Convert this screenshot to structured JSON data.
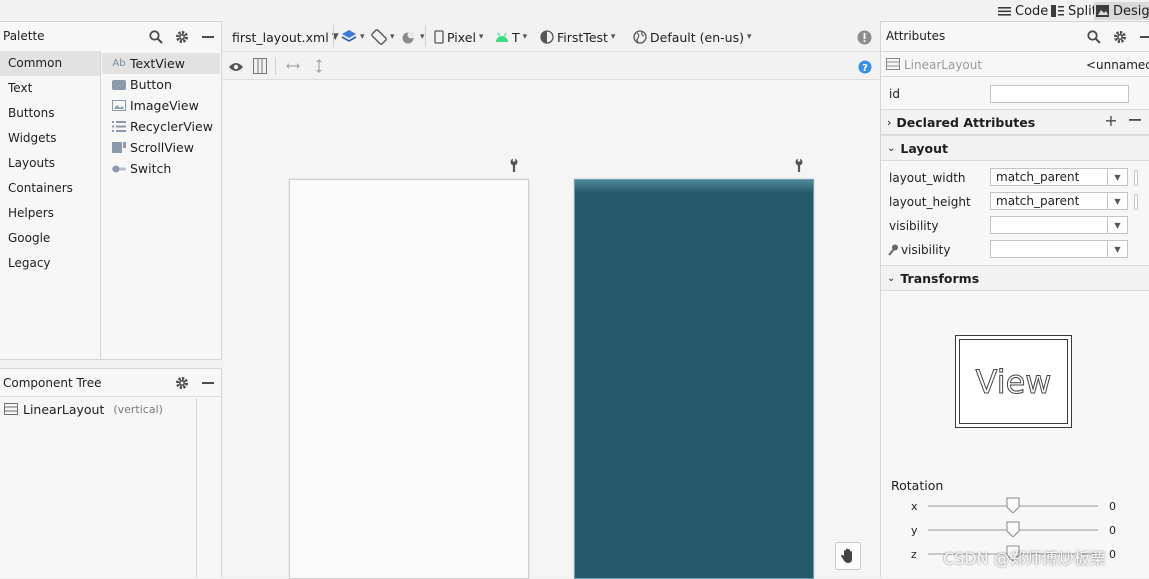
{
  "topbar": {
    "modes": [
      {
        "label": "Code",
        "icon": "code-icon"
      },
      {
        "label": "Split",
        "icon": "split-icon"
      },
      {
        "label": "Design",
        "icon": "design-icon"
      }
    ]
  },
  "palette": {
    "title": "Palette",
    "categories": [
      "Common",
      "Text",
      "Buttons",
      "Widgets",
      "Layouts",
      "Containers",
      "Helpers",
      "Google",
      "Legacy"
    ],
    "selected_category": "Common",
    "widgets": [
      {
        "label": "TextView",
        "icon": "textview-icon",
        "glyph": "Ab"
      },
      {
        "label": "Button",
        "icon": "button-icon"
      },
      {
        "label": "ImageView",
        "icon": "imageview-icon"
      },
      {
        "label": "RecyclerView",
        "icon": "recyclerview-icon"
      },
      {
        "label": "ScrollView",
        "icon": "scrollview-icon"
      },
      {
        "label": "Switch",
        "icon": "switch-icon"
      }
    ]
  },
  "component_tree": {
    "title": "Component Tree",
    "root": {
      "label": "LinearLayout",
      "detail": "(vertical)"
    }
  },
  "editor_toolbar": {
    "file": "first_layout.xml",
    "device": "Pixel",
    "api": "T",
    "theme": "FirstTest",
    "locale": "Default (en-us)"
  },
  "attributes": {
    "title": "Attributes",
    "component": "LinearLayout",
    "component_name": "<unnamed>",
    "id_label": "id",
    "id_value": "",
    "declared_section": "Declared Attributes",
    "layout_section": "Layout",
    "layout_rows": [
      {
        "label": "layout_width",
        "value": "match_parent"
      },
      {
        "label": "layout_height",
        "value": "match_parent"
      },
      {
        "label": "visibility",
        "value": ""
      },
      {
        "label": "visibility",
        "value": ""
      }
    ],
    "transforms_section": "Transforms",
    "view_preview": "View",
    "rotation_label": "Rotation",
    "rotation": [
      {
        "axis": "x",
        "value": "0"
      },
      {
        "axis": "y",
        "value": "0"
      },
      {
        "axis": "z",
        "value": "0"
      }
    ]
  },
  "colors": {
    "blueprint": "#245b6b",
    "design_canvas": "#fafafa"
  },
  "watermark": "CSDN @郑师傅炒板栗"
}
